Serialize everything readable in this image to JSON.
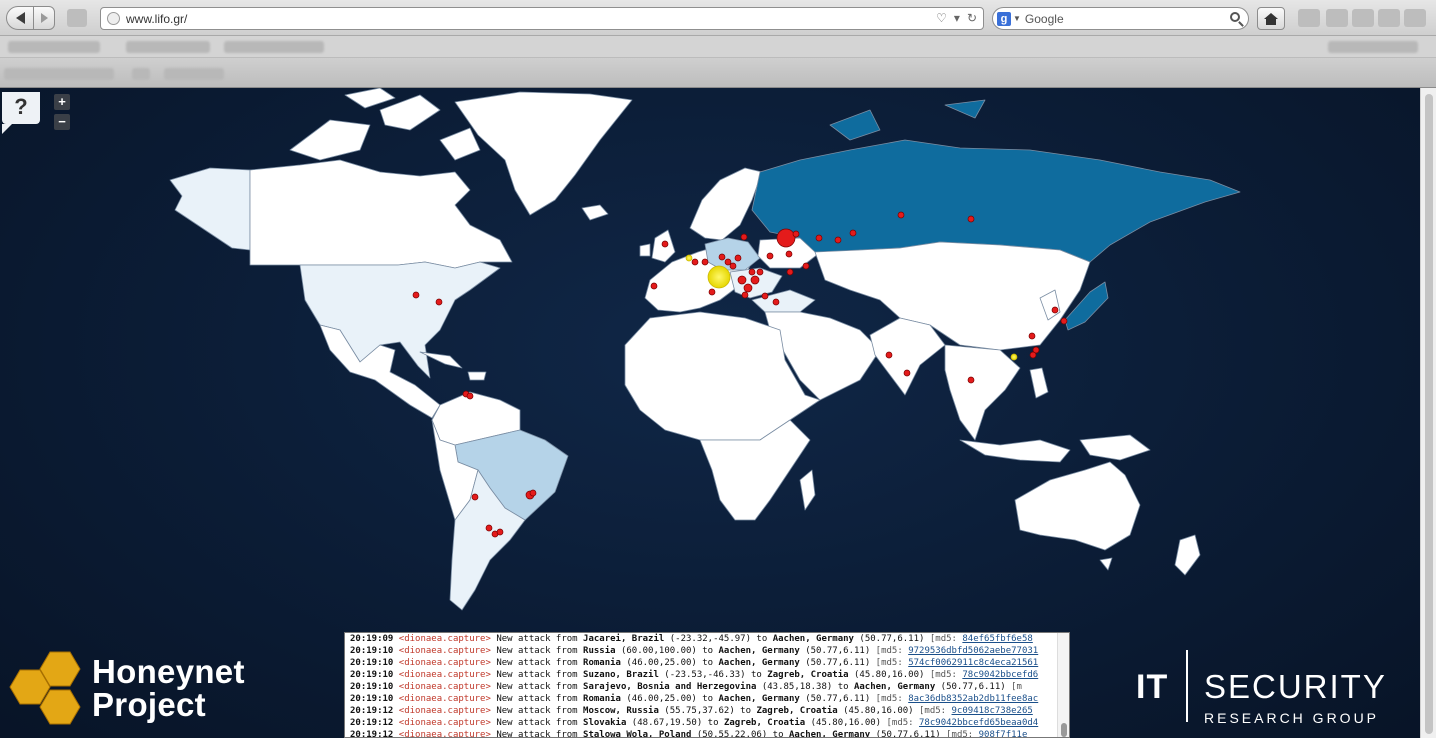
{
  "browser": {
    "url": "www.lifo.gr/",
    "search_placeholder": "Google",
    "search_engine_icon": "google-icon"
  },
  "map": {
    "help_label": "?",
    "zoom_in_label": "+",
    "zoom_out_label": "−",
    "colors": {
      "ocean": "#0b1c35",
      "land": "#ffffff",
      "light_blue": "#b5d3e8",
      "very_light": "#e9f2f9",
      "russia": "#0f6c9e",
      "marker_red": "#e41b1b",
      "marker_yellow": "#f2ea1c"
    }
  },
  "honeynet": {
    "line1": "Honeynet",
    "line2": "Project"
  },
  "its": {
    "it": "IT",
    "security": "SECURITY",
    "research": "RESEARCH GROUP"
  },
  "log": [
    {
      "time": "20:19:09",
      "source": "<dionaea.capture>",
      "text": " New attack from ",
      "from": "Jacarei, Brazil",
      "from_coord": " (-23.32,-45.97)",
      "to_word": " to ",
      "to": "Aachen, Germany",
      "to_coord": " (50.77,6.11)",
      "md5_label": " [md5: ",
      "md5": "84ef65fbf6e58"
    },
    {
      "time": "20:19:10",
      "source": "<dionaea.capture>",
      "text": " New attack from ",
      "from": "Russia",
      "from_coord": " (60.00,100.00)",
      "to_word": " to ",
      "to": "Aachen, Germany",
      "to_coord": " (50.77,6.11)",
      "md5_label": " [md5: ",
      "md5": "9729536dbfd5062aebe77031"
    },
    {
      "time": "20:19:10",
      "source": "<dionaea.capture>",
      "text": " New attack from ",
      "from": "Romania",
      "from_coord": " (46.00,25.00)",
      "to_word": " to ",
      "to": "Aachen, Germany",
      "to_coord": " (50.77,6.11)",
      "md5_label": " [md5: ",
      "md5": "574cf0062911c8c4eca21561"
    },
    {
      "time": "20:19:10",
      "source": "<dionaea.capture>",
      "text": " New attack from ",
      "from": "Suzano, Brazil",
      "from_coord": " (-23.53,-46.33)",
      "to_word": " to ",
      "to": "Zagreb, Croatia",
      "to_coord": " (45.80,16.00)",
      "md5_label": " [md5: ",
      "md5": "78c9042bbcefd6"
    },
    {
      "time": "20:19:10",
      "source": "<dionaea.capture>",
      "text": " New attack from ",
      "from": "Sarajevo, Bosnia and Herzegovina",
      "from_coord": " (43.85,18.38)",
      "to_word": " to ",
      "to": "Aachen, Germany",
      "to_coord": " (50.77,6.11)",
      "md5_label": " [m",
      "md5": ""
    },
    {
      "time": "20:19:10",
      "source": "<dionaea.capture>",
      "text": " New attack from ",
      "from": "Romania",
      "from_coord": " (46.00,25.00)",
      "to_word": " to ",
      "to": "Aachen, Germany",
      "to_coord": " (50.77,6.11)",
      "md5_label": " [md5: ",
      "md5": "8ac36db8352ab2db11fee8ac"
    },
    {
      "time": "20:19:12",
      "source": "<dionaea.capture>",
      "text": " New attack from ",
      "from": "Moscow, Russia",
      "from_coord": " (55.75,37.62)",
      "to_word": " to ",
      "to": "Zagreb, Croatia",
      "to_coord": " (45.80,16.00)",
      "md5_label": " [md5: ",
      "md5": "9c09418c738e265"
    },
    {
      "time": "20:19:12",
      "source": "<dionaea.capture>",
      "text": " New attack from ",
      "from": "Slovakia",
      "from_coord": " (48.67,19.50)",
      "to_word": " to ",
      "to": "Zagreb, Croatia",
      "to_coord": " (45.80,16.00)",
      "md5_label": " [md5: ",
      "md5": "78c9042bbcefd65beaa0d4"
    },
    {
      "time": "20:19:12",
      "source": "<dionaea.capture>",
      "text": " New attack from ",
      "from": "Stalowa Wola, Poland",
      "from_coord": " (50.55,22.06)",
      "to_word": " to ",
      "to": "Aachen, Germany",
      "to_coord": " (50.77,6.11)",
      "md5_label": " [md5: ",
      "md5": "908f7f11e"
    }
  ]
}
